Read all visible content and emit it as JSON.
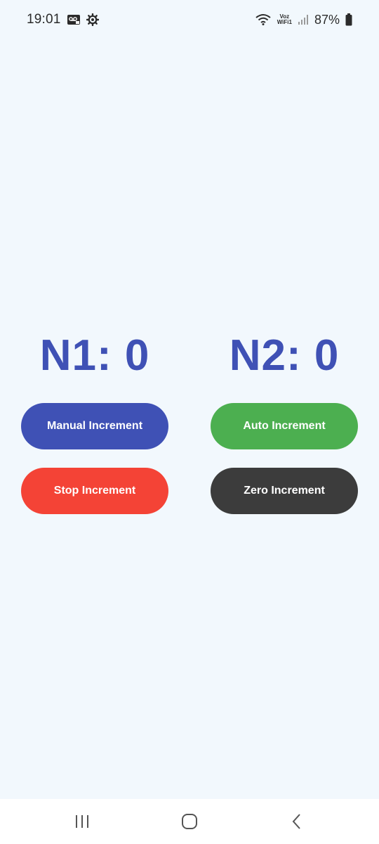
{
  "status_bar": {
    "time": "19:01",
    "left_icons": [
      "voicemail-icon",
      "settings-gear-icon"
    ],
    "right_icons": [
      "wifi-calling-icon",
      "signal-icon",
      "battery-icon"
    ],
    "voz_top": "Voz",
    "voz_bottom": "WiFi1",
    "battery_percent": "87%"
  },
  "counters": {
    "n1": "N1: 0",
    "n2": "N2: 0"
  },
  "buttons": {
    "manual": "Manual Increment",
    "auto": "Auto Increment",
    "stop": "Stop Increment",
    "zero": "Zero Increment"
  },
  "colors": {
    "background": "#f2f8fd",
    "counter_text": "#3f51b5",
    "manual": "#3f51b5",
    "auto": "#4caf50",
    "stop": "#f44336",
    "zero": "#3c3c3c"
  },
  "nav_bar": {
    "icons": [
      "recent-apps-icon",
      "home-icon",
      "back-icon"
    ]
  }
}
